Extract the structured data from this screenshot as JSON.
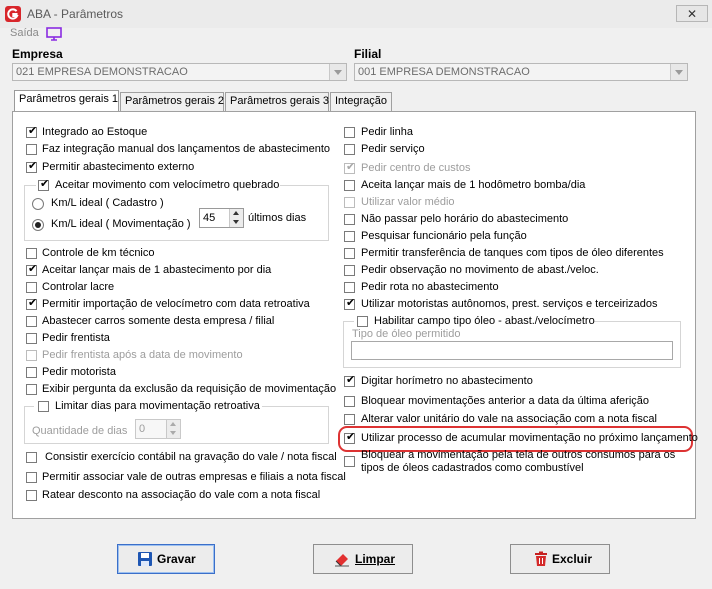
{
  "window": {
    "title": "ABA - Parâmetros",
    "close": "✕"
  },
  "menu": {
    "saida": "Saída"
  },
  "empresa": {
    "label": "Empresa",
    "value": "021 EMPRESA DEMONSTRACAO"
  },
  "filial": {
    "label": "Filial",
    "value": "001 EMPRESA DEMONSTRACAO"
  },
  "tabs": [
    {
      "label": "Parâmetros gerais 1",
      "active": true
    },
    {
      "label": "Parâmetros gerais 2",
      "active": false
    },
    {
      "label": "Parâmetros gerais 3",
      "active": false
    },
    {
      "label": "Integração",
      "active": false
    }
  ],
  "left": {
    "integrado": {
      "label": "Integrado ao Estoque",
      "checked": true
    },
    "faz_integracao": {
      "label": "Faz integração manual dos lançamentos de abastecimento",
      "checked": false
    },
    "permitir_externo": {
      "label": "Permitir abastecimento externo",
      "checked": true
    },
    "velocimetro_group": {
      "label": "Aceitar movimento com velocímetro quebrado",
      "checked": true,
      "radio1": {
        "label": "Km/L ideal ( Cadastro )",
        "selected": false
      },
      "radio2": {
        "label": "Km/L ideal ( Movimentação )",
        "selected": true
      },
      "dias_value": "45",
      "dias_label": "últimos dias"
    },
    "controle_km": {
      "label": "Controle de km técnico",
      "checked": false
    },
    "aceitar_mais": {
      "label": "Aceitar lançar mais de 1 abastecimento por dia",
      "checked": true
    },
    "controlar_lacre": {
      "label": "Controlar lacre",
      "checked": false
    },
    "permitir_importacao": {
      "label": "Permitir importação de velocímetro com data retroativa",
      "checked": true
    },
    "abastecer_carros": {
      "label": "Abastecer carros somente desta empresa / filial",
      "checked": false
    },
    "pedir_frentista": {
      "label": "Pedir frentista",
      "checked": false
    },
    "pedir_frentista_apos": {
      "label": "Pedir frentista após a data de movimento",
      "checked": false
    },
    "pedir_motorista": {
      "label": "Pedir motorista",
      "checked": false
    },
    "exibir_pergunta": {
      "label": "Exibir pergunta da exclusão da requisição de movimentação",
      "checked": false
    },
    "limitar_group": {
      "label": "Limitar dias para movimentação retroativa",
      "checked": false,
      "qtd_label": "Quantidade de dias",
      "qtd_value": "0"
    },
    "consistir": {
      "label": "Consistir exercício contábil na gravação do vale / nota fiscal",
      "checked": false
    },
    "permitir_associar": {
      "label": "Permitir associar vale de outras empresas e filiais a nota fiscal",
      "checked": false
    },
    "ratear": {
      "label": "Ratear desconto na associação do vale com a nota fiscal",
      "checked": false
    }
  },
  "right": {
    "pedir_linha": {
      "label": "Pedir linha",
      "checked": false
    },
    "pedir_servico": {
      "label": "Pedir serviço",
      "checked": false
    },
    "pedir_centro": {
      "label": "Pedir centro de custos",
      "checked": true
    },
    "aceita_lancar": {
      "label": "Aceita lançar mais de 1 hodômetro bomba/dia",
      "checked": false
    },
    "utilizar_valor": {
      "label": "Utilizar valor médio",
      "checked": false
    },
    "nao_passar": {
      "label": "Não passar pelo horário do abastecimento",
      "checked": false
    },
    "pesquisar_func": {
      "label": "Pesquisar funcionário pela função",
      "checked": false
    },
    "permitir_transf": {
      "label": "Permitir transferência de tanques com tipos de óleo diferentes",
      "checked": false
    },
    "pedir_obs": {
      "label": "Pedir observação no movimento de abast./veloc.",
      "checked": false
    },
    "pedir_rota": {
      "label": "Pedir rota no abastecimento",
      "checked": false
    },
    "utilizar_motoristas": {
      "label": "Utilizar motoristas autônomos, prest. serviços e terceirizados",
      "checked": true
    },
    "tipo_oleo_group": {
      "label": "Habilitar campo tipo óleo - abast./velocímetro",
      "checked": false,
      "field_label": "Tipo de óleo permitido",
      "field_value": ""
    },
    "digitar_horimetro": {
      "label": "Digitar horímetro no abastecimento",
      "checked": true
    },
    "bloquear_anterior": {
      "label": "Bloquear movimentações anterior a data da última aferição",
      "checked": false
    },
    "alterar_valor": {
      "label": "Alterar valor unitário do vale na associação com a nota fiscal",
      "checked": false
    },
    "utilizar_processo": {
      "label": "Utilizar processo de acumular movimentação no próximo lançamento",
      "checked": true
    },
    "bloquear_mov_line1": "Bloquear a movimentação pela tela de outros consumos para os",
    "bloquear_mov_line2": "tipos de óleos cadastrados como combustível",
    "bloquear_mov_checked": false
  },
  "buttons": {
    "gravar": "Gravar",
    "limpar": "Limpar",
    "excluir": "Excluir"
  },
  "check_mark": "✔",
  "colors": {
    "highlight": "#dd3333",
    "accent": "#3b6fc9"
  }
}
